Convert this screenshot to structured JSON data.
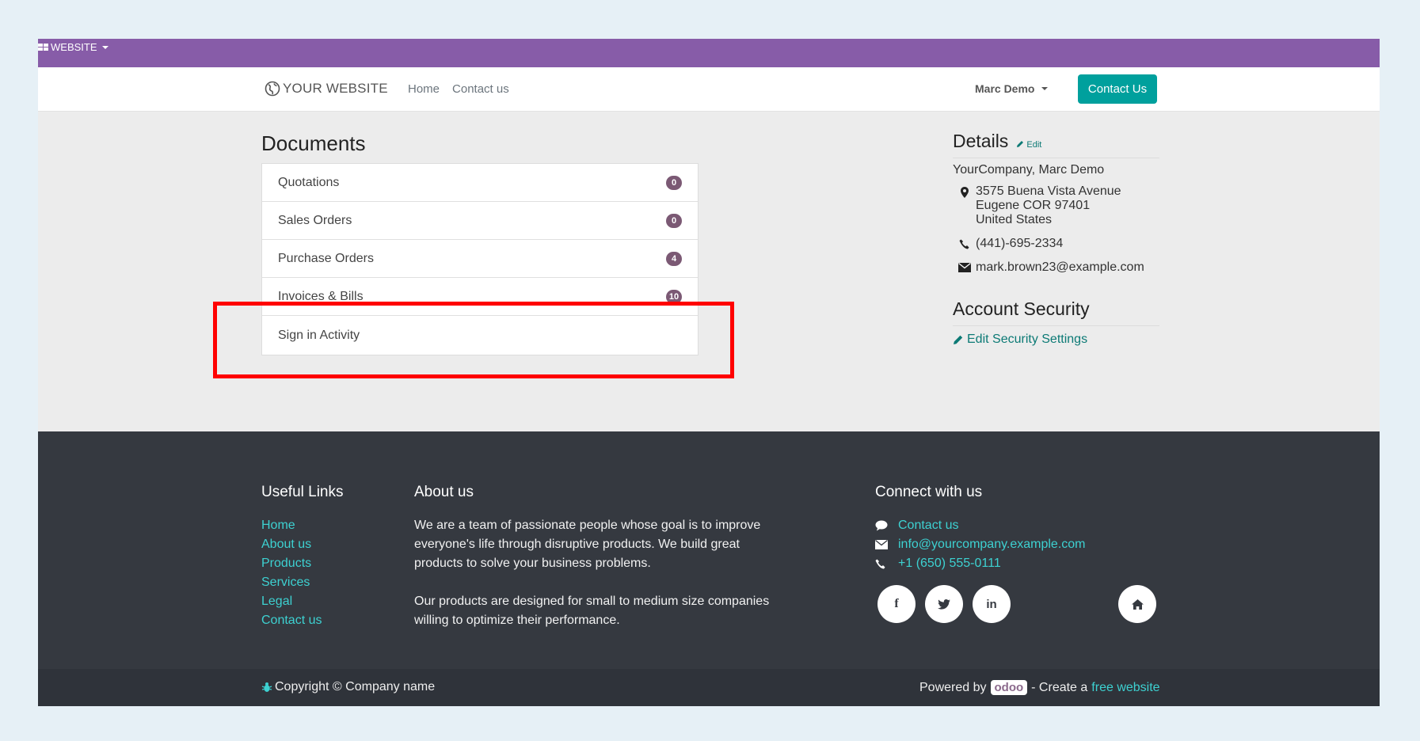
{
  "admin_bar": {
    "label": "WEBSITE"
  },
  "navbar": {
    "brand": "YOUR WEBSITE",
    "links": [
      "Home",
      "Contact us"
    ],
    "user": "Marc Demo",
    "cta": "Contact Us"
  },
  "documents": {
    "title": "Documents",
    "items": [
      {
        "label": "Quotations",
        "count": "0"
      },
      {
        "label": "Sales Orders",
        "count": "0"
      },
      {
        "label": "Purchase Orders",
        "count": "4"
      },
      {
        "label": "Invoices & Bills",
        "count": "10"
      },
      {
        "label": "Sign in Activity",
        "count": ""
      }
    ]
  },
  "details": {
    "title": "Details",
    "edit": "Edit",
    "company": "YourCompany, Marc Demo",
    "address": [
      "3575 Buena Vista Avenue",
      "Eugene COR 97401",
      "United States"
    ],
    "phone": "(441)-695-2334",
    "email": "mark.brown23@example.com"
  },
  "security": {
    "title": "Account Security",
    "link": "Edit Security Settings"
  },
  "footer": {
    "useful_title": "Useful Links",
    "useful_links": [
      "Home",
      "About us",
      "Products",
      "Services",
      "Legal",
      "Contact us"
    ],
    "about_title": "About us",
    "about_p1": "We are a team of passionate people whose goal is to improve everyone's life through disruptive products. We build great products to solve your business problems.",
    "about_p2": "Our products are designed for small to medium size companies willing to optimize their performance.",
    "connect_title": "Connect with us",
    "connect_contact": "Contact us",
    "connect_email": "info@yourcompany.example.com",
    "connect_phone": "+1 (650) 555-0111",
    "social": {
      "facebook": "f",
      "linkedin": "in"
    }
  },
  "bottom": {
    "copyright": "Copyright © Company name",
    "powered_by": "Powered by",
    "odoo": "odoo",
    "create": "- Create a",
    "free_website": "free website"
  },
  "colors": {
    "admin_bar": "#875ca8",
    "accent": "#00a09d",
    "badge": "#7b5974",
    "highlight": "#ff0000",
    "footer": "#353940"
  }
}
